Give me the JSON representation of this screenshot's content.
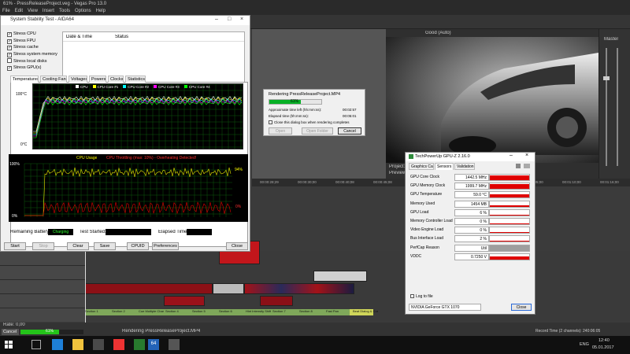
{
  "vegas": {
    "title": "61% - PressReleaseProject.veg - Vegas Pro 13.0",
    "menu": [
      "File",
      "Edit",
      "View",
      "Insert",
      "Tools",
      "Options",
      "Help"
    ],
    "preview_quality": "Good (Auto)",
    "master_label": "Master",
    "project_label": "Project:",
    "preview_label": "Preview:",
    "ruler_ticks": [
      "00:00:28;29",
      "00:00:30;00",
      "00:00:40;08",
      "00:00:45;08",
      "00:00:48;29",
      "00:00:52;29",
      "00:01:00;00",
      "00:01:05;00",
      "00:01:10;00",
      "00:01:16;00"
    ],
    "rate_label": "Rate: 0,00",
    "cancel_label": "Cancel",
    "progress_label": "61%",
    "render_status": "Rendering PressReleaseProject.MP4",
    "record_time": "Record Time (2 channels): 240:06:05",
    "progress_fraction": 0.61,
    "markers": [
      "Section 1",
      "Section 2",
      "Cue Multiple Char",
      "Section 4",
      "Section 5",
      "Section 6",
      "Hint Intensity Shift",
      "Section 7",
      "Section 8",
      "Fast Pan",
      "Beat Dialog & Cue"
    ]
  },
  "aida": {
    "title": "System Stability Test - AIDA64",
    "checks": [
      {
        "label": "Stress CPU",
        "checked": true
      },
      {
        "label": "Stress FPU",
        "checked": true
      },
      {
        "label": "Stress cache",
        "checked": true
      },
      {
        "label": "Stress system memory",
        "checked": true
      },
      {
        "label": "Stress local disks",
        "checked": false
      },
      {
        "label": "Stress GPU(s)",
        "checked": true
      }
    ],
    "log_headers": [
      "Date & Time",
      "Status"
    ],
    "tabs": [
      "Temperatures",
      "Cooling Fans",
      "Voltages",
      "Powers",
      "Clocks",
      "Statistics"
    ],
    "temp_legend": [
      "CPU",
      "CPU Core #1",
      "CPU Core #2",
      "CPU Core #3",
      "CPU Core #4"
    ],
    "temp_top": "100°C",
    "temp_bottom": "0°C",
    "usage_title": "CPU Usage",
    "usage_throttle": "CPU Throttling (max: 10%) - Overheating Detected!",
    "usage_top": "100%",
    "usage_bottom": "0%",
    "usage_right1": "94%",
    "usage_right2": "0%",
    "battery_label": "Remaining Battery:",
    "battery_value": "Charging",
    "started_label": "Test Started:",
    "elapsed_label": "Elapsed Time:",
    "buttons": {
      "start": "Start",
      "stop": "Stop",
      "clear": "Clear",
      "save": "Save",
      "cpuid": "CPUID",
      "preferences": "Preferences",
      "close": "Close"
    }
  },
  "render": {
    "title": "Rendering PressReleaseProject.MP4",
    "percent": "61%",
    "fraction": 0.61,
    "left_label": "Approximate time left (hh:mm:ss):",
    "left_value": "00:02:57",
    "elapsed_label": "Elapsed time (hh:mm:ss):",
    "elapsed_value": "00:05:01",
    "close_check": "Close this dialog box when rendering completes",
    "open": "Open",
    "open_folder": "Open Folder",
    "cancel": "Cancel"
  },
  "gpuz": {
    "title": "TechPowerUp GPU-Z 2.16.0",
    "tabs": [
      "Graphics Card",
      "Sensors",
      "Validation"
    ],
    "rows": [
      {
        "label": "GPU Core Clock",
        "value": "1442.5 MHz",
        "level": 0.85
      },
      {
        "label": "GPU Memory Clock",
        "value": "1999.7 MHz",
        "level": 0.85
      },
      {
        "label": "GPU Temperature",
        "value": "59.0 °C",
        "level": 0.6
      },
      {
        "label": "Memory Used",
        "value": "1454 MB",
        "level": 0.3
      },
      {
        "label": "GPU Load",
        "value": "6 %",
        "level": 0.06
      },
      {
        "label": "Memory Controller Load",
        "value": "0 %",
        "level": 0.02
      },
      {
        "label": "Video Engine Load",
        "value": "0 %",
        "level": 0.02
      },
      {
        "label": "Bus Interface Load",
        "value": "2 %",
        "level": 0.03
      },
      {
        "label": "PerfCap Reason",
        "value": "Util",
        "level": 1.0
      },
      {
        "label": "VDDC",
        "value": "0.7250 V",
        "level": 0.5
      }
    ],
    "log_label": "Log to file",
    "card": "NVIDIA GeForce GTX 1070",
    "close": "Close",
    "bar_color": "#e00000",
    "perfcap_color": "#9e9e9e"
  },
  "taskbar": {
    "time": "12:40",
    "date": "05.01.2017",
    "lang": "ENG"
  }
}
